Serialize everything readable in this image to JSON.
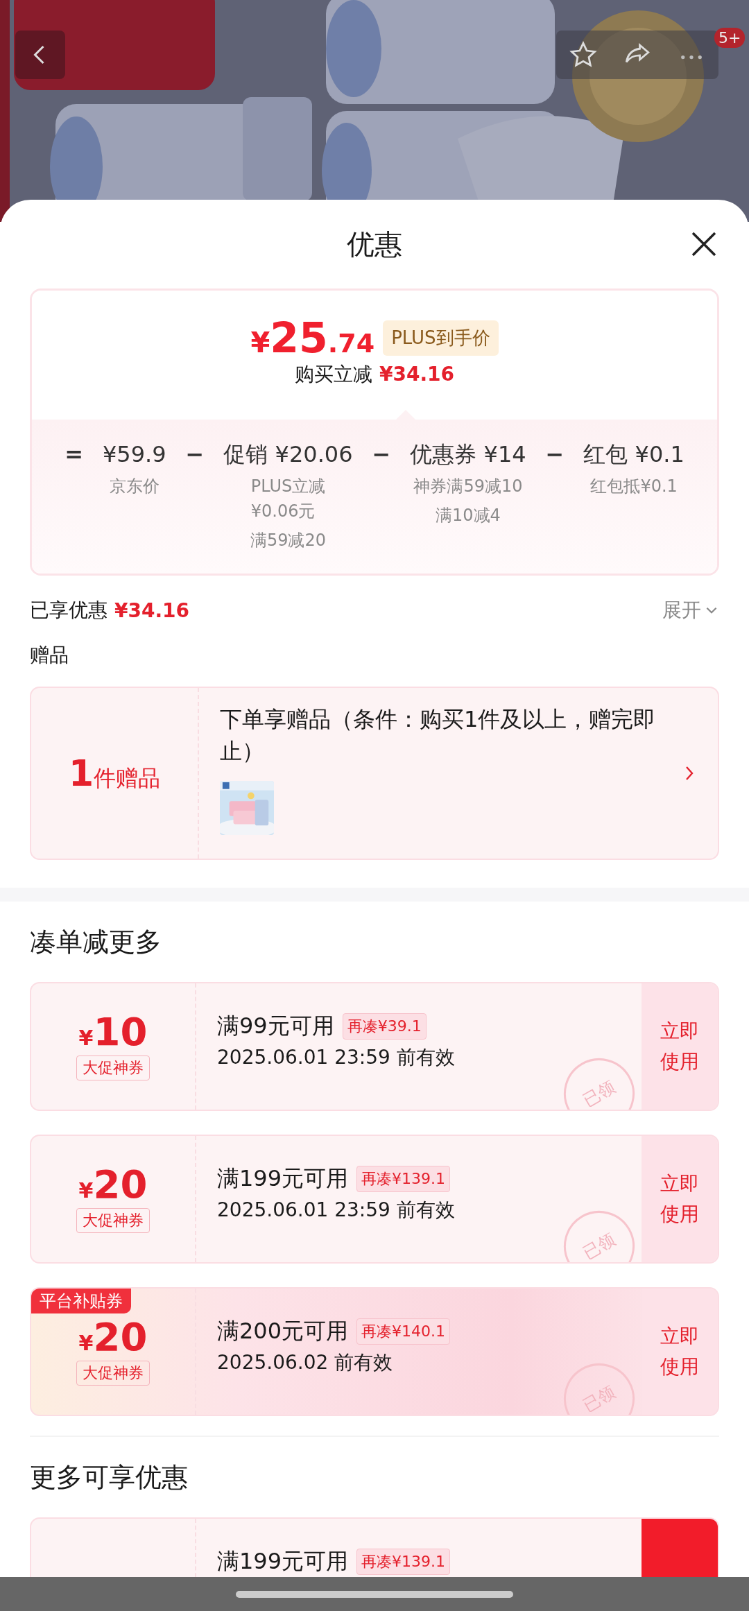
{
  "header": {
    "cart_badge": "5+"
  },
  "sheet": {
    "title": "优惠"
  },
  "price_box": {
    "currency": "¥",
    "price_int": "25",
    "price_dec": ".74",
    "price_tag": "PLUS到手价",
    "saving_label": "购买立减",
    "saving_value": "¥34.16",
    "breakdown": [
      {
        "operator": "=",
        "value": "¥59.9",
        "notes": [
          "京东价"
        ]
      },
      {
        "operator": "−",
        "value": "促销 ¥20.06",
        "notes": [
          "PLUS立减\n¥0.06元",
          "满59减20"
        ]
      },
      {
        "operator": "−",
        "value": "优惠券 ¥14",
        "notes": [
          "神券满59减10",
          "满10减4"
        ]
      },
      {
        "operator": "−",
        "value": "红包 ¥0.1",
        "notes": [
          "红包抵¥0.1"
        ]
      }
    ]
  },
  "enjoyed": {
    "label": "已享优惠",
    "value": "¥34.16",
    "toggle": "展开",
    "expanded": false
  },
  "gift_section": {
    "title": "赠品",
    "count": "1",
    "count_unit": "件赠品",
    "description": "下单享赠品（条件：购买1件及以上，赠完即止）"
  },
  "bundle_section": {
    "title": "凑单减更多",
    "coupons": [
      {
        "kind": "normal",
        "currency": "¥",
        "amount": "10",
        "label": "大促神券",
        "condition": "满99元可用",
        "gap": "再凑¥39.1",
        "validity": "2025.06.01 23:59 前有效",
        "button": "立即使用",
        "button_filled": false,
        "stamp": "已领"
      },
      {
        "kind": "normal",
        "currency": "¥",
        "amount": "20",
        "label": "大促神券",
        "condition": "满199元可用",
        "gap": "再凑¥139.1",
        "validity": "2025.06.01 23:59 前有效",
        "button": "立即使用",
        "button_filled": false,
        "stamp": "已领"
      },
      {
        "kind": "platform",
        "tag": "平台补贴券",
        "currency": "¥",
        "amount": "20",
        "label": "大促神券",
        "condition": "满200元可用",
        "gap": "再凑¥140.1",
        "validity": "2025.06.02 前有效",
        "button": "立即使用",
        "button_filled": false,
        "stamp": "已领"
      }
    ]
  },
  "more_section": {
    "title": "更多可享优惠",
    "coupons": [
      {
        "condition": "满199元可用",
        "gap": "再凑¥139.1",
        "button_filled": true
      }
    ]
  }
}
